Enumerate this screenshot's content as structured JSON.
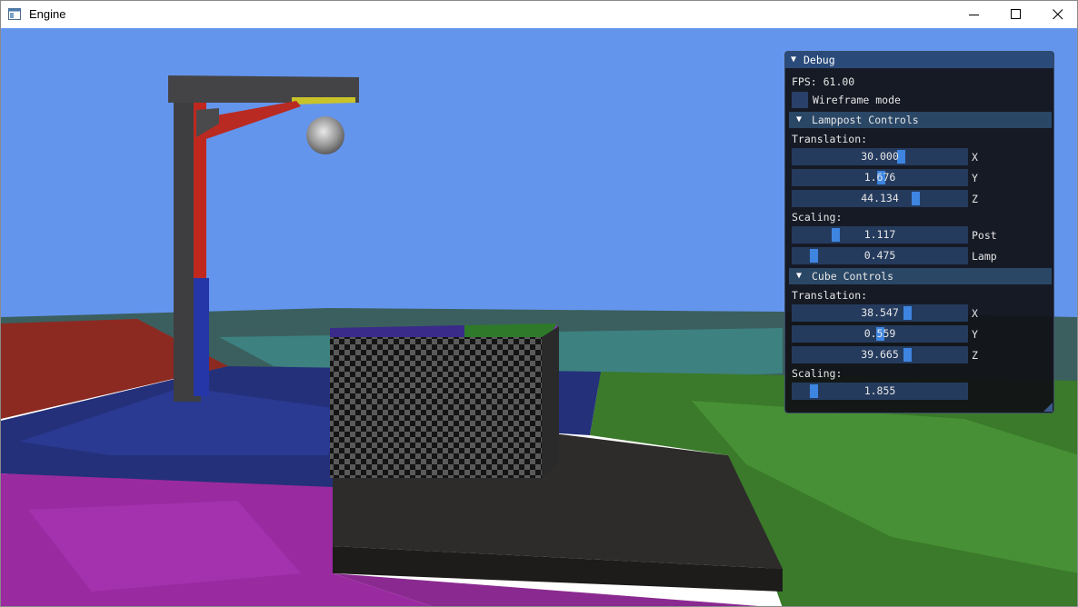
{
  "window": {
    "title": "Engine"
  },
  "debug": {
    "title": "Debug",
    "fps_text": "FPS: 61.00",
    "wireframe_label": "Wireframe mode",
    "wireframe_checked": false,
    "lamppost": {
      "header": "Lamppost Controls",
      "translation_label": "Translation:",
      "translation": [
        {
          "value": "30.000",
          "axis": "X",
          "fraction": 0.63
        },
        {
          "value": "1.676",
          "axis": "Y",
          "fraction": 0.51
        },
        {
          "value": "44.134",
          "axis": "Z",
          "fraction": 0.72
        }
      ],
      "scaling_label": "Scaling:",
      "scaling": [
        {
          "value": "1.117",
          "axis": "Post",
          "fraction": 0.23
        },
        {
          "value": "0.475",
          "axis": "Lamp",
          "fraction": 0.1
        }
      ]
    },
    "cube": {
      "header": "Cube Controls",
      "translation_label": "Translation:",
      "translation": [
        {
          "value": "38.547",
          "axis": "X",
          "fraction": 0.67
        },
        {
          "value": "0.559",
          "axis": "Y",
          "fraction": 0.5
        },
        {
          "value": "39.665",
          "axis": "Z",
          "fraction": 0.67
        }
      ],
      "scaling_label": "Scaling:",
      "scaling": [
        {
          "value": "1.855",
          "axis": "",
          "fraction": 0.1
        }
      ]
    }
  }
}
